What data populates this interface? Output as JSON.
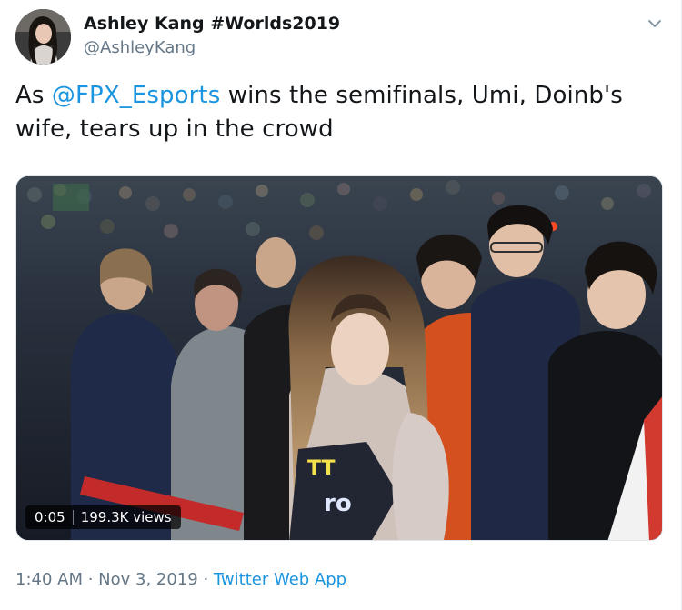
{
  "author": {
    "name": "Ashley Kang #Worlds2019",
    "handle": "@AshleyKang",
    "avatar_icon": "avatar-photo"
  },
  "tweet": {
    "text_before": "As ",
    "mention": "@FPX_Esports",
    "text_after": " wins the semifinals, Umi, Doinb's wife, tears up in the crowd"
  },
  "media": {
    "duration": "0:05",
    "views": "199.3K views"
  },
  "meta": {
    "time": "1:40 AM",
    "separator": " · ",
    "date": "Nov 3, 2019",
    "app": "Twitter Web App"
  },
  "menu": {
    "icon": "chevron-down-icon"
  },
  "colors": {
    "link": "#1b95e0",
    "secondary": "#657786",
    "text": "#14171a"
  }
}
